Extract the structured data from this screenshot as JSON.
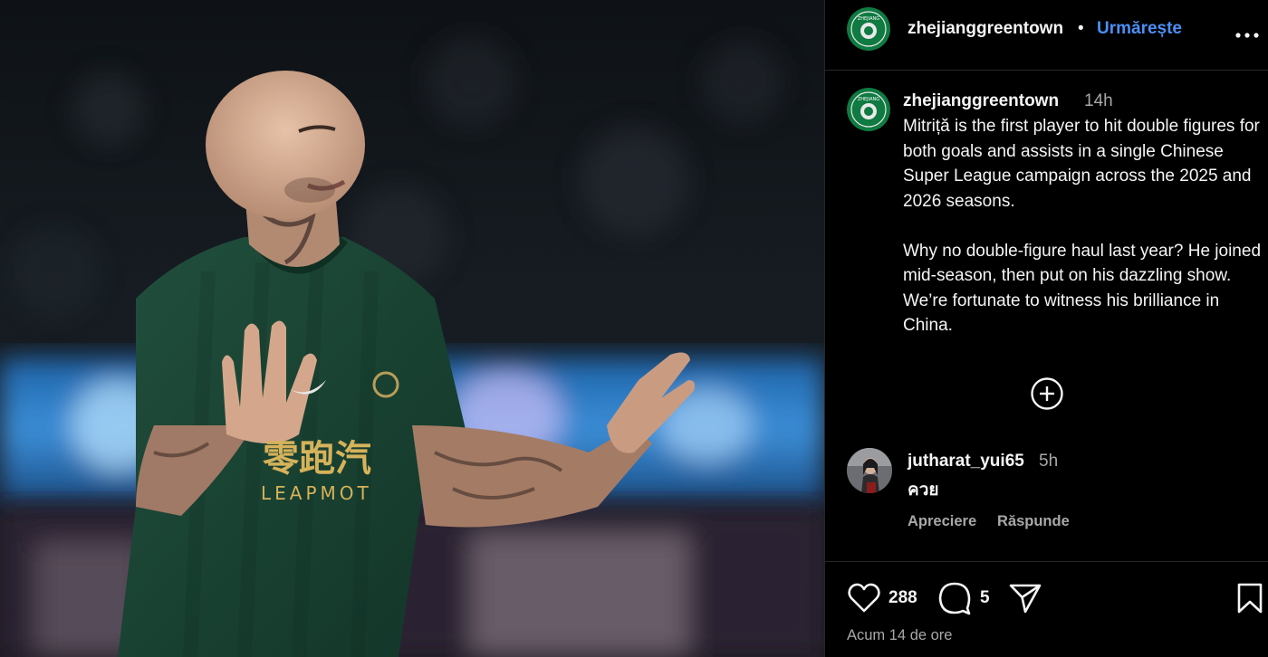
{
  "post": {
    "username": "zhejianggreentown",
    "follow_label": "Urmărește",
    "separator": "•",
    "logo_text": "ZHEJIANG",
    "image": {
      "jersey_text_cn": "零跑汽",
      "jersey_text_en": "LEAPMOT"
    }
  },
  "caption": {
    "username": "zhejianggreentown",
    "time": "14h",
    "text": "Mitriță is the first player to hit double figures for both goals and assists in a single Chinese Super League campaign across the 2025 and 2026 seasons.\n\nWhy no double-figure haul last year? He joined mid-season, then put on his dazzling show. We’re fortunate to witness his brilliance in China."
  },
  "comment": {
    "username": "jutharat_yui65",
    "time": "5h",
    "text": "ควย",
    "like_label": "Apreciere",
    "reply_label": "Răspunde"
  },
  "actions": {
    "likes": "288",
    "comments": "5",
    "posted": "Acum 14 de ore"
  },
  "icons": {
    "more": "more-icon",
    "add_comments": "plus-circle-icon",
    "like": "heart-icon",
    "comment": "comment-icon",
    "share": "send-icon",
    "save": "bookmark-icon"
  },
  "colors": {
    "follow": "#4c8ff5",
    "brand_green": "#0f7a41",
    "secondary_text": "#a8a8a8",
    "jersey_green": "#1b4a38"
  }
}
